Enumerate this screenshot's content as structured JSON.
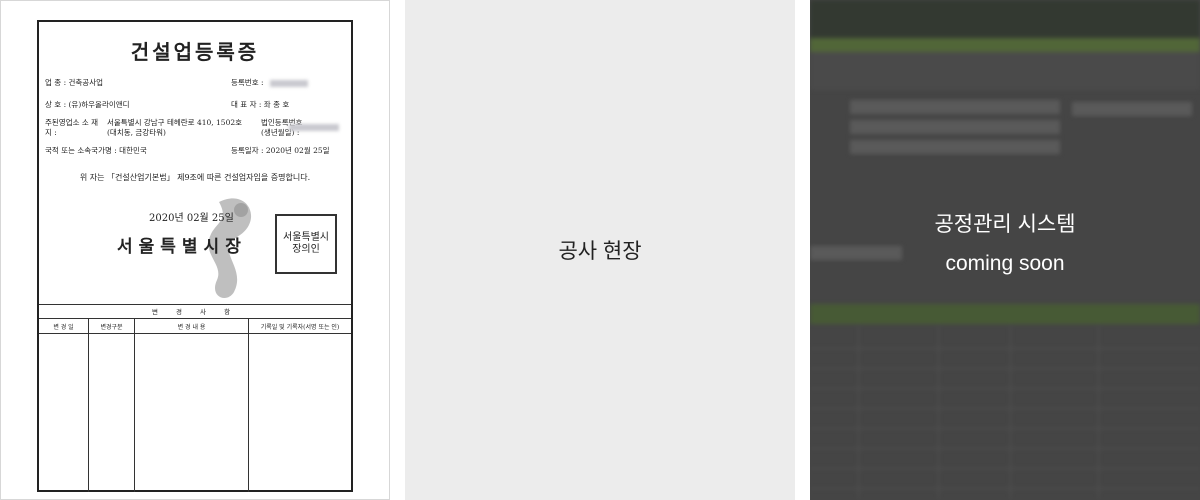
{
  "panels": {
    "certificate": {
      "title": "건설업등록증",
      "fields": {
        "industry_label": "업 종 :",
        "industry_value": "건축공사업",
        "reg_no_label": "등록번호 :",
        "company_label": "상 호 :",
        "company_value": "(유)하우올라이앤디",
        "ceo_label": "대 표 자 :",
        "ceo_value": "좌 종 호",
        "address_label": "주된영업소 소 재 지 :",
        "address_value_1": "서울특별시 강남구 테헤란로 410, 1502호",
        "address_value_2": "(대치동, 금강타워)",
        "corp_no_label": "법인등록번호 (생년월일) :",
        "nationality_label": "국적 또는 소속국가명 :",
        "nationality_value": "대한민국",
        "reg_date_label": "등록일자 :",
        "reg_date_value": "2020년 02월 25일"
      },
      "statement": "위 자는 「건설산업기본법」 제9조에 따른 건설업자임을 증명합니다.",
      "issue_date": "2020년 02월 25일",
      "issuer": "서울특별시장",
      "seal_text": "서울특별시장의인",
      "table_header": "변 경 사 항",
      "table_columns": [
        "변 경 일",
        "변경구분",
        "변 경 내 용",
        "기록일 및 기록자(서명 또는 인)"
      ]
    },
    "site": {
      "label": "공사 현장"
    },
    "system": {
      "title": "공정관리 시스템",
      "subtitle": "coming soon"
    }
  },
  "colors": {
    "middle_bg": "#ececec",
    "overlay_text": "#ffffff",
    "system_green": "#5d7d37"
  }
}
